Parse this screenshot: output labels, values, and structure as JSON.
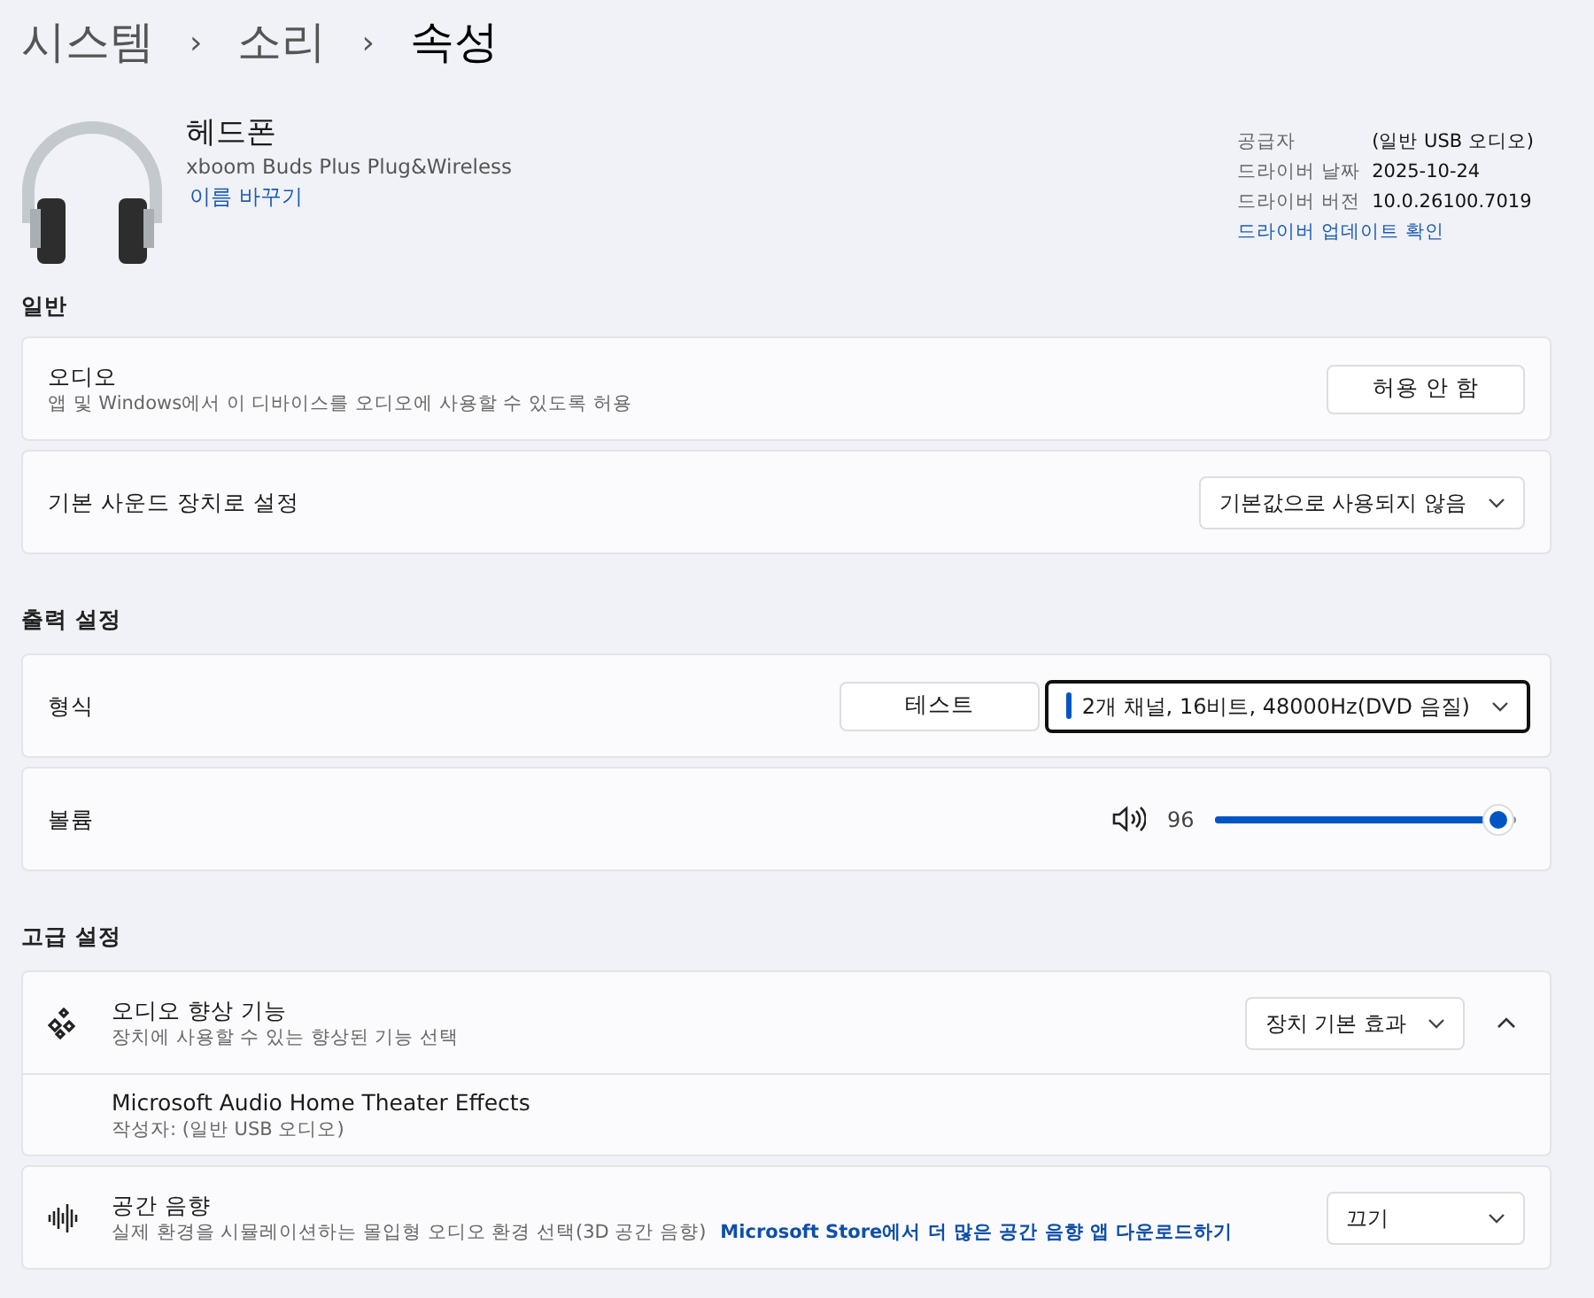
{
  "breadcrumb": {
    "items": [
      {
        "label": "시스템",
        "current": false
      },
      {
        "label": "소리",
        "current": false
      },
      {
        "label": "속성",
        "current": true
      }
    ],
    "separators": [
      "›",
      "›"
    ]
  },
  "device": {
    "name": "헤드폰",
    "model": "xboom Buds Plus Plug&Wireless",
    "rename_link": "이름 바꾸기"
  },
  "driver_info": [
    {
      "label": "공급자",
      "value": "(일반 USB 오디오)"
    },
    {
      "label": "드라이버 날짜",
      "value": "2025-10-24"
    },
    {
      "label": "드라이버 버전",
      "value": "10.0.26100.7019"
    }
  ],
  "driver_update_link": "드라이버 업데이트 확인",
  "sections": [
    {
      "title": "일반",
      "cards": [
        {
          "kind": "button",
          "title": "오디오",
          "subtitle": "앱 및 Windows에서 이 디바이스를 오디오에 사용할 수 있도록 허용",
          "button": "허용 안 함"
        },
        {
          "kind": "dropdown",
          "title": "기본 사운드 장치로 설정",
          "value": "기본값으로 사용되지 않음",
          "focused": false
        }
      ]
    },
    {
      "title": "출력 설정",
      "cards": [
        {
          "kind": "format",
          "title": "형식",
          "button": "테스트",
          "value": "2개 채널, 16비트, 48000Hz(DVD 음질)",
          "focused": true
        },
        {
          "kind": "slider",
          "title": "볼륨",
          "reading": "96",
          "level": 0.96
        }
      ]
    },
    {
      "title": "고급 설정",
      "cards": [
        {
          "kind": "expander",
          "title": "오디오 향상 기능",
          "subtitle": "장치에 사용할 수 있는 향상된 기능 선택",
          "value": "장치 기본 효과",
          "expanded": true,
          "detail": {
            "title": "Microsoft Audio Home Theater Effects",
            "subtitle": "작성자: (일반 USB 오디오)"
          }
        },
        {
          "kind": "dropdown",
          "title": "공간 음향",
          "subtitle": "실제 환경을 시뮬레이션하는 몰입형 오디오 환경 선택(3D 공간 음향)",
          "link": "Microsoft Store에서 더 많은 공간 음향 앱 다운로드하기",
          "value": "끄기",
          "focused": false
        }
      ]
    }
  ]
}
